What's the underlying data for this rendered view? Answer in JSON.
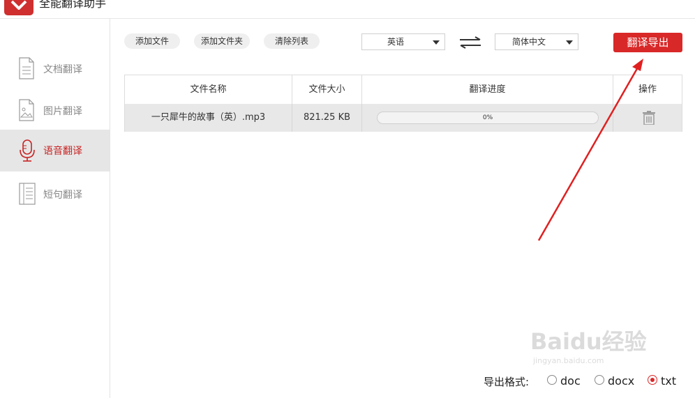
{
  "app": {
    "title": "全能翻译助手"
  },
  "sidebar": {
    "items": [
      {
        "label": "文档翻译",
        "icon": "document-icon",
        "active": false
      },
      {
        "label": "图片翻译",
        "icon": "image-icon",
        "active": false
      },
      {
        "label": "语音翻译",
        "icon": "microphone-icon",
        "active": true
      },
      {
        "label": "短句翻译",
        "icon": "text-lines-icon",
        "active": false
      }
    ]
  },
  "toolbar": {
    "add_file": "添加文件",
    "add_folder": "添加文件夹",
    "clear_list": "清除列表",
    "source_lang": "英语",
    "target_lang": "简体中文",
    "export_button": "翻译导出"
  },
  "table": {
    "headers": [
      "文件名称",
      "文件大小",
      "翻译进度",
      "操作"
    ],
    "rows": [
      {
        "name": "一只犀牛的故事（英）.mp3",
        "size": "821.25 KB",
        "progress": 0,
        "progress_text": "0%",
        "action_icon": "trash-icon"
      }
    ]
  },
  "export_format": {
    "label": "导出格式:",
    "options": [
      "doc",
      "docx",
      "txt"
    ],
    "selected": "txt"
  },
  "watermark": {
    "text": "Baidu经验",
    "sub": "jingyan.baidu.com"
  },
  "colors": {
    "accent": "#d92828",
    "sidebar_active_bg": "#e6e6e6"
  }
}
